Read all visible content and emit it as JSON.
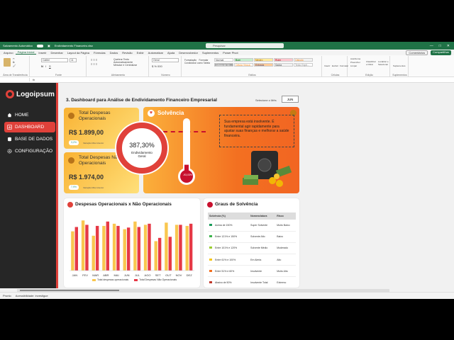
{
  "titlebar": {
    "autosave": "Salvamento Automático",
    "filename": "Endividamento Financeiro.xlsx",
    "search_placeholder": "Pesquisar",
    "minimize": "—",
    "maximize": "□",
    "close": "✕"
  },
  "menu": {
    "items": [
      "Arquivo",
      "Página Inicial",
      "Inserir",
      "Desenhar",
      "Layout da Página",
      "Fórmulas",
      "Dados",
      "Revisão",
      "Exibir",
      "Automatizar",
      "Ajuda",
      "Desenvolvedor",
      "Suplementos",
      "Power Pivot"
    ],
    "active_index": 1,
    "comments": "Comentários",
    "share": "Compartilhar"
  },
  "ribbon": {
    "groups": [
      "Área de Transferência",
      "Fonte",
      "Alinhamento",
      "Número",
      "Estilos",
      "Células",
      "Edição",
      "Suplementos"
    ],
    "font_name": "Calibri",
    "font_size": "11",
    "number_format": "Geral",
    "wrap_text": "Quebrar Texto Automaticamente",
    "merge": "Mesclar e Centralizar",
    "styles": [
      "Normal",
      "Bom",
      "Neutro",
      "Ruim",
      "Cálculo",
      "Célula de Ve...",
      "Célula Vincul...",
      "Entrada",
      "Saída",
      "Texto Expli..."
    ],
    "cond_format": "Formatação Condicional",
    "table_format": "Formatar como Tabela",
    "insert": "Inserir",
    "delete": "Excluir",
    "format": "Formatar",
    "autosum": "AutoSoma",
    "fill": "Preencher",
    "clear": "Limpar",
    "sort": "Classificar e Filtrar",
    "find": "Localizar e Selecionar",
    "addins": "Suplementos"
  },
  "formula_bar": {
    "fx": "fx"
  },
  "sidebar": {
    "logo": "Logoipsum",
    "items": [
      "HOME",
      "DASHBOARD",
      "BASE DE DADOS",
      "CONFIGURAÇÃO"
    ],
    "active_index": 1
  },
  "header": {
    "title": "3. Dashboard para Análise de Endividamento Financeiro Empresarial",
    "month_label": "Selecione o Mês",
    "month_value": "JUN"
  },
  "kpis": [
    {
      "title": "Total Despesas Operacionais",
      "value": "R$ 1.899,00",
      "badge": "3,2%",
      "note": "Variação Mês Anterior"
    },
    {
      "title": "Total Despesas Não Operacionais",
      "value": "R$ 1.974,00",
      "badge": "7,9%",
      "note": "Variação Mês Anterior"
    }
  ],
  "gauge": {
    "value": "387,30%",
    "label": "Endividamento Geral"
  },
  "solvency": {
    "title": "Solvência",
    "message": "Sua empresa está insolvente. É fundamental agir rapidamente para ajustar suas finanças e melhorar a saúde financeira.",
    "thermo_value": "-93,03%",
    "thermo_level": 0.18
  },
  "expenses_panel": {
    "title": "Despesas Operacionais x Não Operacionais",
    "legend_op": "Total despesas operacionais",
    "legend_nop": "Total Despesas Não Operacionais"
  },
  "chart_data": {
    "type": "bar",
    "categories": [
      "JAN",
      "FEV",
      "MAR",
      "ABR",
      "MAI",
      "JUN",
      "JUL",
      "AGO",
      "SET",
      "OUT",
      "NOV",
      "DEZ"
    ],
    "series": [
      {
        "name": "Total despesas operacionais",
        "values": [
          1800,
          2300,
          1600,
          2050,
          2150,
          1899,
          2250,
          2100,
          1350,
          2200,
          2100,
          2050
        ]
      },
      {
        "name": "Total Despesas Não Operacionais",
        "values": [
          2000,
          2100,
          2050,
          2250,
          2050,
          1974,
          2000,
          2150,
          1500,
          1550,
          2100,
          2150
        ]
      }
    ],
    "ylim": [
      0,
      2600
    ],
    "legend": "bottom"
  },
  "solvency_panel": {
    "title": "Graus de Solvência",
    "headers": [
      "Solvência (%)",
      "Nomenclatura",
      "Risco"
    ],
    "rows": [
      {
        "range": "Acima de 150%",
        "name": "Super Solvente",
        "risk": "Muito Baixo",
        "color": "#1a9c5a"
      },
      {
        "range": "Entre 121% e 150%",
        "name": "Solvente Alto",
        "risk": "Baixo",
        "color": "#3cb44b"
      },
      {
        "range": "Entre 101% e 120%",
        "name": "Solvente Médio",
        "risk": "Moderado",
        "color": "#9acd32"
      },
      {
        "range": "Entre 61% e 100%",
        "name": "Em Alerta",
        "risk": "Alto",
        "color": "#f5c518"
      },
      {
        "range": "Entre 51% e 60%",
        "name": "Insolvente",
        "risk": "Muito Alto",
        "color": "#f37021"
      },
      {
        "range": "Abaixo de 50%",
        "name": "Insolvente Total",
        "risk": "Extremo",
        "color": "#c0392b"
      }
    ]
  },
  "status": {
    "ready": "Pronto",
    "accessibility": "Acessibilidade: investigue"
  },
  "colors": {
    "accent": "#e0413a",
    "excel_green": "#1f7246",
    "bar_op": "#f9c74f",
    "bar_nop": "#e63946"
  }
}
